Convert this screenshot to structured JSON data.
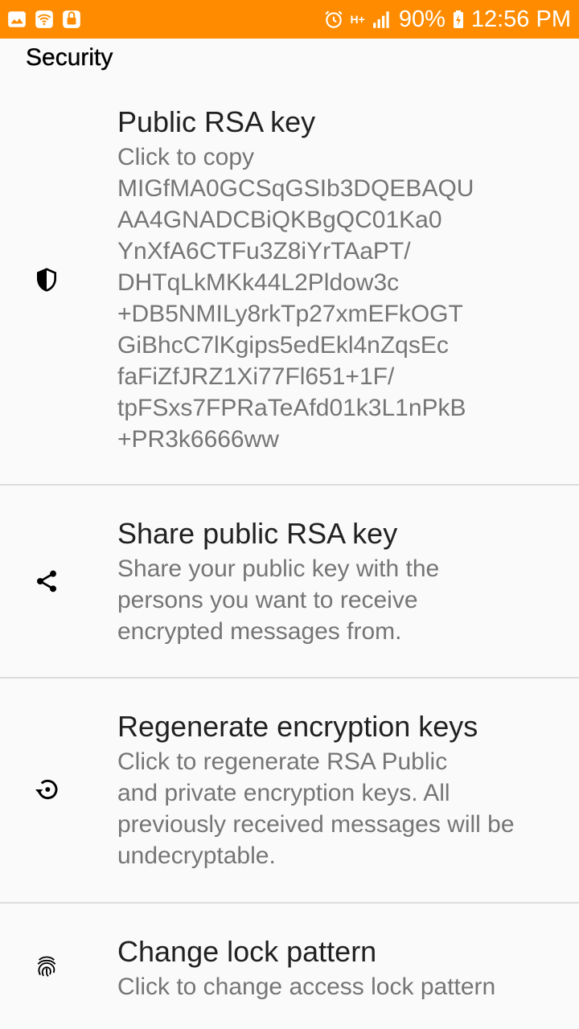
{
  "status_bar": {
    "battery": "90%",
    "time": "12:56 PM",
    "network": "H+",
    "color": "#ff8c00"
  },
  "header": {
    "title": "Security"
  },
  "prefs": [
    {
      "title": "Public RSA key",
      "summary_lines": [
        "Click to copy",
        "MIGfMA0GCSqGSIb3DQEBAQU",
        "AA4GNADCBiQKBgQC01Ka0",
        "YnXfA6CTFu3Z8iYrTAaPT/",
        "DHTqLkMKk44L2Pldow3c",
        "+DB5NMILy8rkTp27xmEFkOGT",
        "GiBhcC7lKgips5edEkl4nZqsEc",
        "faFiZfJRZ1Xi77Fl651+1F/",
        "tpFSxs7FPRaTeAfd01k3L1nPkB",
        "+PR3k6666ww"
      ],
      "icon": "shield-icon"
    },
    {
      "title": "Share public RSA key",
      "summary_lines": [
        "Share your public key with the",
        "persons you want to receive",
        "encrypted messages from."
      ],
      "icon": "share-icon"
    },
    {
      "title": "Regenerate encryption keys",
      "summary_lines": [
        "Click to regenerate RSA Public",
        "and private encryption keys. All",
        "previously received messages will be",
        "undecryptable."
      ],
      "icon": "restore-icon"
    },
    {
      "title": "Change lock pattern",
      "summary_lines": [
        "Click to change access lock pattern"
      ],
      "icon": "fingerprint-icon"
    }
  ]
}
